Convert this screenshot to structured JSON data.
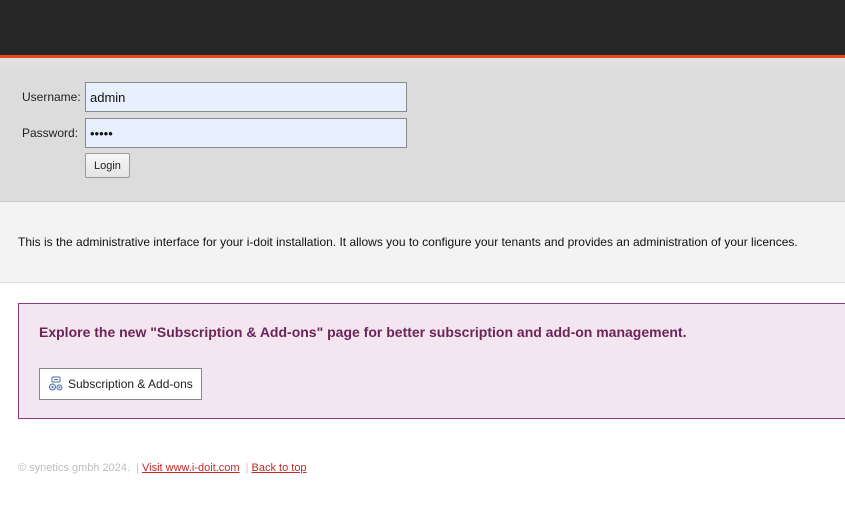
{
  "login": {
    "username_label": "Username:",
    "username_value": "admin",
    "password_label": "Password:",
    "password_value": "admin",
    "login_button": "Login"
  },
  "info": {
    "text": "This is the administrative interface for your i-doit installation. It allows you to configure your tenants and provides an administration of your licences."
  },
  "promo": {
    "title": "Explore the new \"Subscription & Add-ons\" page for better subscription and add-on management.",
    "button_label": "Subscription & Add-ons",
    "button_icon": "addons-icon"
  },
  "footer": {
    "copyright": "© synetics gmbh 2024.",
    "separator": "|",
    "visit_link": "Visit www.i-doit.com",
    "back_link": "Back to top"
  },
  "colors": {
    "topbar": "#262626",
    "accent": "#e8491d",
    "promo_bg": "#f4e6f0",
    "promo_border": "#8e3a80",
    "promo_title": "#6b2358",
    "link": "#c62828"
  }
}
